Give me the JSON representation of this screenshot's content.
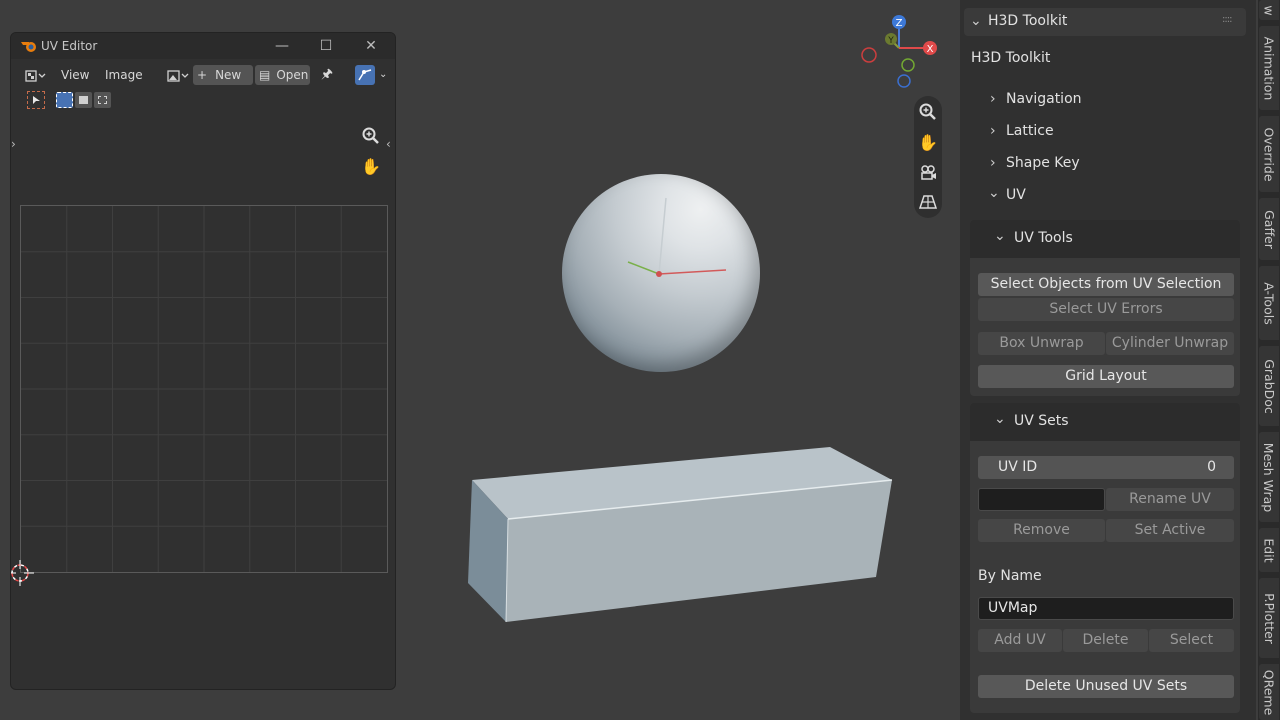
{
  "uv_editor": {
    "title": "UV Editor",
    "menu": {
      "view": "View",
      "image": "Image"
    },
    "new_label": "New",
    "open_label": "Open"
  },
  "viewport": {
    "gizmo": {
      "x": "X",
      "y": "Y",
      "z": "Z"
    }
  },
  "sidebar": {
    "panel_header": "H3D Toolkit",
    "panel_title": "H3D Toolkit",
    "sections": [
      "Navigation",
      "Lattice",
      "Shape Key",
      "UV"
    ],
    "uv_tools": {
      "header": "UV Tools",
      "select_objects": "Select Objects from UV Selection",
      "select_errors": "Select UV Errors",
      "box_unwrap": "Box Unwrap",
      "cylinder_unwrap": "Cylinder Unwrap",
      "grid_layout": "Grid Layout"
    },
    "uv_sets": {
      "header": "UV Sets",
      "uv_id_label": "UV ID",
      "uv_id_value": "0",
      "rename_uv": "Rename UV",
      "remove": "Remove",
      "set_active": "Set Active",
      "by_name_label": "By Name",
      "name_value": "UVMap",
      "add_uv": "Add UV",
      "delete": "Delete",
      "select": "Select",
      "delete_unused": "Delete Unused UV Sets"
    }
  },
  "tabs": [
    "w",
    "Animation",
    "Override",
    "Gaffer",
    "A-Tools",
    "GrabDoc",
    "Mesh Wrap",
    "Edit",
    "P.Plotter",
    "QReme"
  ]
}
